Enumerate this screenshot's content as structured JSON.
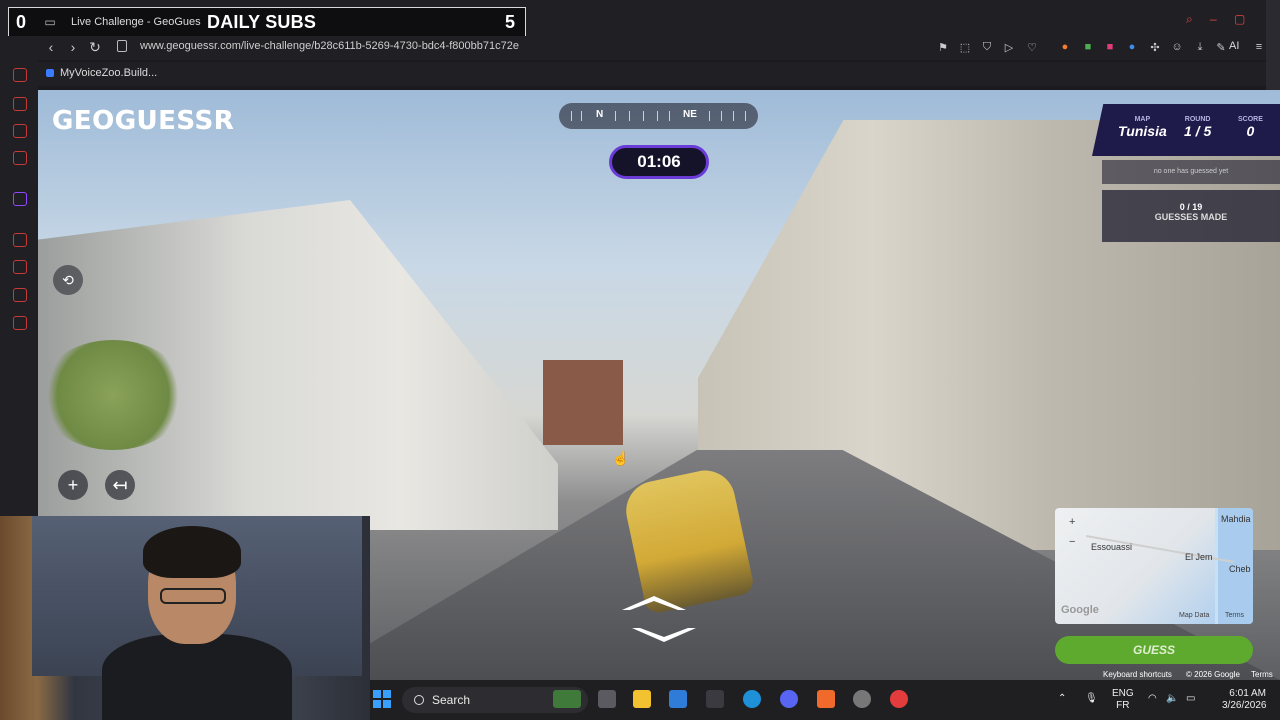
{
  "browser": {
    "tab_count": "0",
    "tab_title": "Live Challenge - GeoGuessr",
    "overlay_label": "DAILY SUBS",
    "overlay_value": "5",
    "url": "www.geoguessr.com/live-challenge/b28c611b-5269-4730-bdc4-f800bb71c72e",
    "ai_label": "AI",
    "bookmark": "MyVoiceZoo.Build..."
  },
  "game": {
    "logo": "GEOGUESSR",
    "compass": {
      "n": "N",
      "ne": "NE"
    },
    "timer": "01:06",
    "hud": {
      "map_label": "MAP",
      "map_value": "Tunisia",
      "round_label": "ROUND",
      "round_value": "1 / 5",
      "score_label": "SCORE",
      "score_value": "0",
      "status": "no one has guessed yet",
      "guesses_count": "0 / 19",
      "guesses_label": "GUESSES MADE"
    },
    "minimap": {
      "places": [
        "Essouassi",
        "El Jem",
        "Mahdia",
        "Cheb"
      ],
      "google": "Google",
      "map_data": "Map Data",
      "terms": "Terms"
    },
    "guess_button": "GUESS",
    "footer": {
      "shortcuts": "Keyboard shortcuts",
      "copyright": "© 2026 Google",
      "terms": "Terms"
    }
  },
  "taskbar": {
    "search": "Search",
    "lang1": "ENG",
    "lang2": "FR",
    "time": "6:01 AM",
    "date": "3/26/2026"
  },
  "colors": {
    "accent_purple": "#6b3bd8",
    "hud_bg": "#1e1b4b",
    "guess_green": "#5eaa2f",
    "brand_red": "#e63c3c"
  }
}
